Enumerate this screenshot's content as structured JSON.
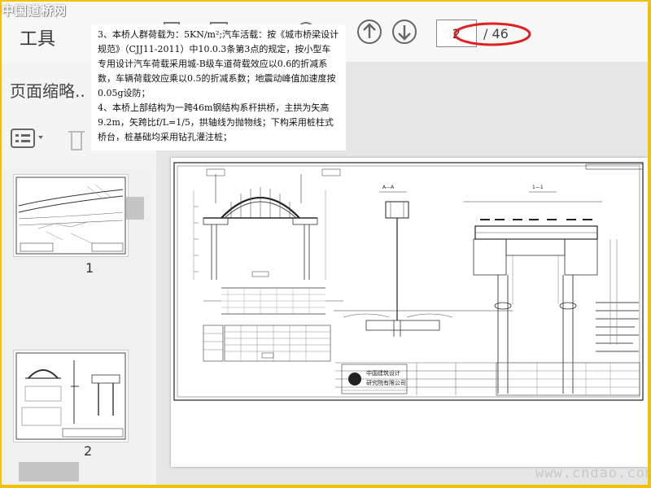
{
  "toolbar": {
    "tools_label": "工具",
    "page_current": "2",
    "page_total": "/ 46",
    "icons": [
      "prev-page-icon",
      "next-page-icon"
    ],
    "callout_color": "#e02020"
  },
  "sidebar": {
    "title": "页面缩略..",
    "thumbnails": [
      {
        "number": "1"
      },
      {
        "number": "2"
      }
    ]
  },
  "document": {
    "notes": [
      "3、本桥人群荷载为：5KN/m²;汽车活载：按《城市桥梁设计规范》（CJJ11-2011）中10.0.3条第3点的规定，按小型车专用设计汽车荷载采用城-B级车道荷载效应以0.6的折减系数，车辆荷载效应乘以0.5的折减系数；地震动峰值加速度按0.05g设防；",
      "4、本桥上部结构为一跨46m钢结构系杆拱桥，主拱为矢高9.2m，矢跨比f/L=1/5，拱轴线为抛物线；下构采用桩柱式桥台，桩基础均采用钻孔灌注桩；"
    ],
    "drawing": {
      "section_labels": [
        "A—A",
        "1—1"
      ],
      "company_line1": "中国建筑设计",
      "company_line2": "研究院有限公司"
    }
  },
  "watermarks": {
    "top": "中国道桥网",
    "bottom": "www.cndao.com"
  }
}
